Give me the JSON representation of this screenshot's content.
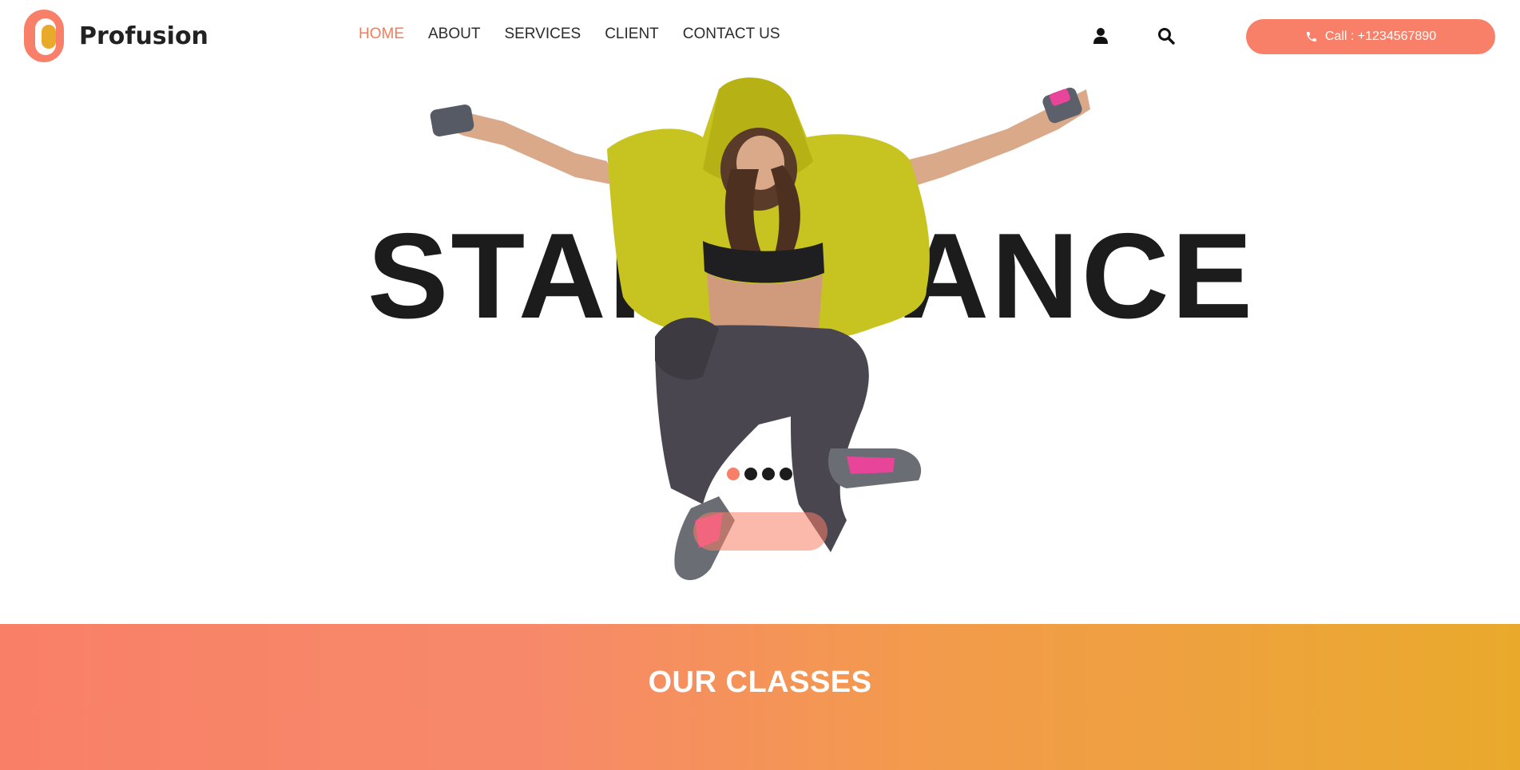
{
  "brand": {
    "name": "Profusion",
    "colors": {
      "accent": "#f88068",
      "gold": "#e9a92b",
      "nav_active": "#f37c59",
      "text_dark": "#1c1c1c"
    }
  },
  "nav": {
    "items": [
      {
        "label": "HOME",
        "active": true
      },
      {
        "label": "ABOUT",
        "active": false
      },
      {
        "label": "SERVICES",
        "active": false
      },
      {
        "label": "CLIENT",
        "active": false
      },
      {
        "label": "CONTACT US",
        "active": false
      }
    ]
  },
  "header_icons": {
    "user": "user-icon",
    "search": "search-icon"
  },
  "call": {
    "label": "Call : +1234567890",
    "icon": "phone-icon"
  },
  "hero": {
    "title": "START DANCE",
    "slide_count": 4,
    "active_slide": 1
  },
  "classes": {
    "title": "OUR CLASSES"
  }
}
